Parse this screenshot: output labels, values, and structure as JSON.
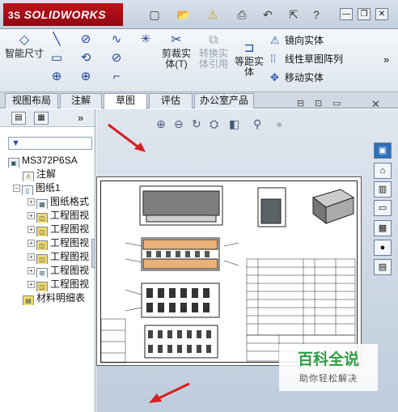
{
  "app": {
    "name": "SOLIDWORKS",
    "logo_prefix": "3S"
  },
  "titlebar": {
    "icons": [
      "new-doc-icon",
      "open-folder-icon",
      "warning-icon",
      "print-icon",
      "undo-icon",
      "select-icon",
      "help-icon"
    ],
    "glyphs": {
      "new": "▢",
      "open": "📂",
      "warn": "⚠",
      "print": "⎙",
      "undo": "↶",
      "select": "⇱",
      "help": "?"
    },
    "window_buttons": {
      "minimize": "—",
      "restore": "❐",
      "close": "✕"
    }
  },
  "ribbon": {
    "smart_dim": "智能尺寸",
    "trim": "剪裁实体(T)",
    "convert": "转换实体引用",
    "offset": "等距实体",
    "mirror": "镜向实体",
    "linear_pattern": "线性草图阵列",
    "move": "移动实体",
    "sketch_glyphs": [
      "╲",
      "⊘",
      "∿",
      "✳",
      "▭",
      "⟲",
      "⊘",
      "⊕",
      "⊏",
      "⊕",
      "⌐"
    ],
    "more": "»"
  },
  "tabs": [
    "视图布局",
    "注解",
    "草图",
    "评估",
    "办公室产品"
  ],
  "active_tab": "草图",
  "left_pane": {
    "expand": "»",
    "filter_symbol": "▼",
    "tree": [
      {
        "label": "MS372P6SA",
        "indent": 0
      },
      {
        "label": "注解",
        "indent": 1
      },
      {
        "label": "图纸1",
        "indent": 1
      },
      {
        "label": "图纸格式",
        "indent": 2
      },
      {
        "label": "工程图视",
        "indent": 2
      },
      {
        "label": "工程图视",
        "indent": 2
      },
      {
        "label": "工程图视",
        "indent": 2
      },
      {
        "label": "工程图视",
        "indent": 2
      },
      {
        "label": "工程图视",
        "indent": 2
      },
      {
        "label": "工程图视",
        "indent": 2
      },
      {
        "label": "材料明细表",
        "indent": 1
      }
    ]
  },
  "viewport": {
    "view_tool_glyphs": [
      "⊕",
      "⊖",
      "↻",
      "⛭",
      "◧",
      "⚲",
      "●"
    ],
    "window_buttons": [
      "⊟",
      "⊡",
      "▭",
      "✕"
    ]
  },
  "watermark": {
    "title": "百科全说",
    "subtitle": "助你轻松解决"
  },
  "colors": {
    "accent_red": "#d42020",
    "sw_red": "#c0101a",
    "watermark_green": "#2f9e44"
  }
}
